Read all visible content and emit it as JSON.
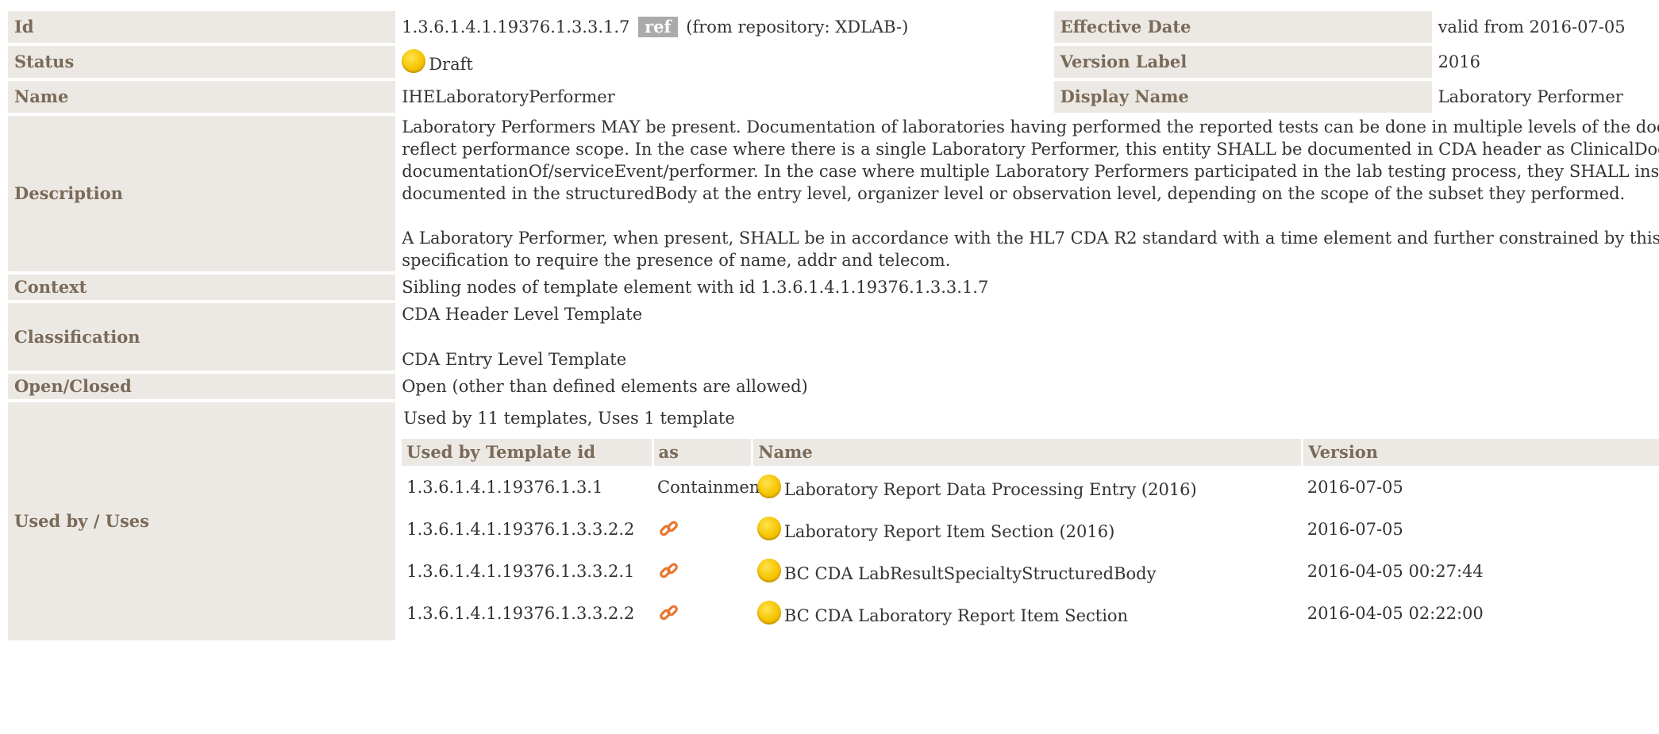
{
  "fields": {
    "id": {
      "label": "Id",
      "value": "1.3.6.1.4.1.19376.1.3.3.1.7",
      "ref_badge": "ref",
      "repository": "(from repository: XDLAB-)"
    },
    "effective_date": {
      "label": "Effective Date",
      "value": "valid from 2016-07-05"
    },
    "status": {
      "label": "Status",
      "value": "Draft",
      "icon": "status-draft-yellow-circle"
    },
    "version_label": {
      "label": "Version Label",
      "value": "2016"
    },
    "name": {
      "label": "Name",
      "value": "IHELaboratoryPerformer"
    },
    "display_name": {
      "label": "Display Name",
      "value": "Laboratory Performer"
    },
    "description": {
      "label": "Description",
      "lines1": [
        "Laboratory Performers MAY be present. Documentation of laboratories having performed the reported tests can be done in multiple levels of the document",
        "reflect performance scope. In the case where there is a single Laboratory Performer, this entity SHALL be documented in CDA header as ClinicalDocument/",
        "documentationOf/serviceEvent/performer. In the case where multiple Laboratory Performers participated in the lab testing process, they SHALL instead be",
        "documented in the structuredBody at the entry level, organizer level or observation level, depending on the scope of the subset they performed."
      ],
      "lines2": [
        "A Laboratory Performer, when present, SHALL be in accordance with the HL7 CDA R2 standard with a time element and further constrained by this",
        "specification to require the presence of name, addr and telecom."
      ]
    },
    "context": {
      "label": "Context",
      "value": "Sibling nodes of template element with id 1.3.6.1.4.1.19376.1.3.3.1.7"
    },
    "classification": {
      "label": "Classification",
      "values": [
        "CDA Header Level Template",
        "CDA Entry Level Template"
      ]
    },
    "open_closed": {
      "label": "Open/Closed",
      "value": "Open (other than defined elements are allowed)"
    },
    "used_by": {
      "label": "Used by / Uses",
      "summary": "Used by 11 templates, Uses 1 template",
      "headers": [
        "Used by Template id",
        "as",
        "Name",
        "Version"
      ],
      "rows": [
        {
          "id": "1.3.6.1.4.1.19376.1.3.1",
          "as": "Containment",
          "as_icon": "",
          "name": "Laboratory Report Data Processing Entry (2016)",
          "version": "2016-07-05"
        },
        {
          "id": "1.3.6.1.4.1.19376.1.3.3.2.2",
          "as": "",
          "as_icon": "link-icon",
          "name": "Laboratory Report Item Section (2016)",
          "version": "2016-07-05"
        },
        {
          "id": "1.3.6.1.4.1.19376.1.3.3.2.1",
          "as": "",
          "as_icon": "link-icon",
          "name": "BC CDA LabResultSpecialtyStructuredBody",
          "version": "2016-04-05 00:27:44"
        },
        {
          "id": "1.3.6.1.4.1.19376.1.3.3.2.2",
          "as": "",
          "as_icon": "link-icon",
          "name": "BC CDA Laboratory Report Item Section",
          "version": "2016-04-05 02:22:00"
        }
      ]
    }
  },
  "colors": {
    "label_bg": "#ece9e4",
    "label_text": "#7a6a58",
    "ref_badge_bg": "#aaaaaa",
    "status_yellow": "#f5c400",
    "link_orange": "#e8772e"
  }
}
